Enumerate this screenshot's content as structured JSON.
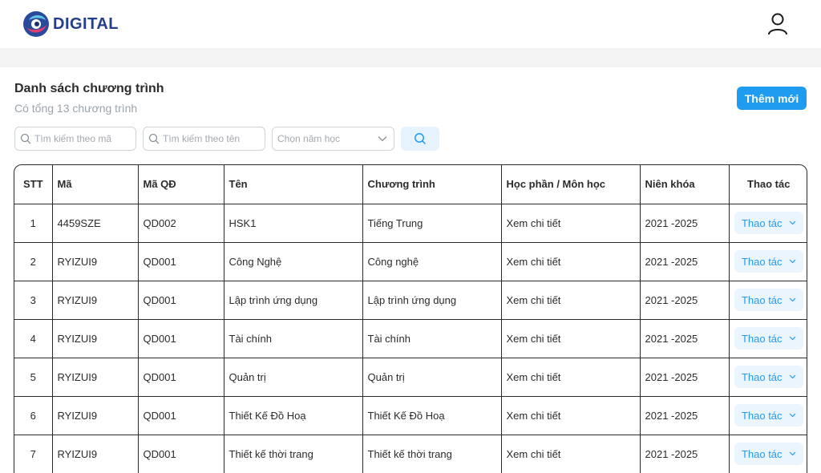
{
  "header": {
    "logo_text": "DIGITAL"
  },
  "page": {
    "title": "Danh sách chương trình",
    "subtitle": "Có tổng 13 chương trình"
  },
  "toolbar": {
    "add_label": "Thêm mới",
    "search_code_placeholder": "Tìm kiếm theo mã",
    "search_name_placeholder": "Tìm kiếm theo tên",
    "year_select_placeholder": "Chọn năm học"
  },
  "table": {
    "columns": [
      "STT",
      "Mã",
      "Mã QĐ",
      "Tên",
      "Chương trình",
      "Học phần / Môn học",
      "Niên khóa",
      "Thao tác"
    ],
    "rows": [
      {
        "stt": "1",
        "code": "4459SZE",
        "decision": "QD002",
        "name": "HSK1",
        "program": "Tiếng Trung",
        "subjects": "Xem chi tiết",
        "years": "2021 -2025",
        "action": "Thao tác"
      },
      {
        "stt": "2",
        "code": "RYIZUI9",
        "decision": "QD001",
        "name": "Công Nghệ",
        "program": "Công nghệ",
        "subjects": "Xem chi tiết",
        "years": "2021 -2025",
        "action": "Thao tác"
      },
      {
        "stt": "3",
        "code": "RYIZUI9",
        "decision": "QD001",
        "name": "Lập trình ứng dụng",
        "program": "Lập trình ứng dụng",
        "subjects": "Xem chi tiết",
        "years": "2021 -2025",
        "action": "Thao tác"
      },
      {
        "stt": "4",
        "code": "RYIZUI9",
        "decision": "QD001",
        "name": "Tài chính",
        "program": "Tài chính",
        "subjects": "Xem chi tiết",
        "years": "2021 -2025",
        "action": "Thao tác"
      },
      {
        "stt": "5",
        "code": "RYIZUI9",
        "decision": "QD001",
        "name": "Quản trị",
        "program": "Quản trị",
        "subjects": "Xem chi tiết",
        "years": "2021 -2025",
        "action": "Thao tác"
      },
      {
        "stt": "6",
        "code": "RYIZUI9",
        "decision": "QD001",
        "name": "Thiết Kế Đồ Hoạ",
        "program": "Thiết Kế Đồ Hoạ",
        "subjects": "Xem chi tiết",
        "years": "2021 -2025",
        "action": "Thao tác"
      },
      {
        "stt": "7",
        "code": "RYIZUI9",
        "decision": "QD001",
        "name": "Thiết kế thời trang",
        "program": "Thiết kế thời trang",
        "subjects": "Xem chi tiết",
        "years": "2021 -2025",
        "action": "Thao tác"
      }
    ]
  },
  "icons": {
    "user": "user-icon",
    "search": "search-icon",
    "chevron": "chevron-down-icon",
    "logo": "logo-icon"
  },
  "colors": {
    "accent": "#1f9cf0",
    "brand": "#23408e",
    "band": "#f4f4f5"
  }
}
